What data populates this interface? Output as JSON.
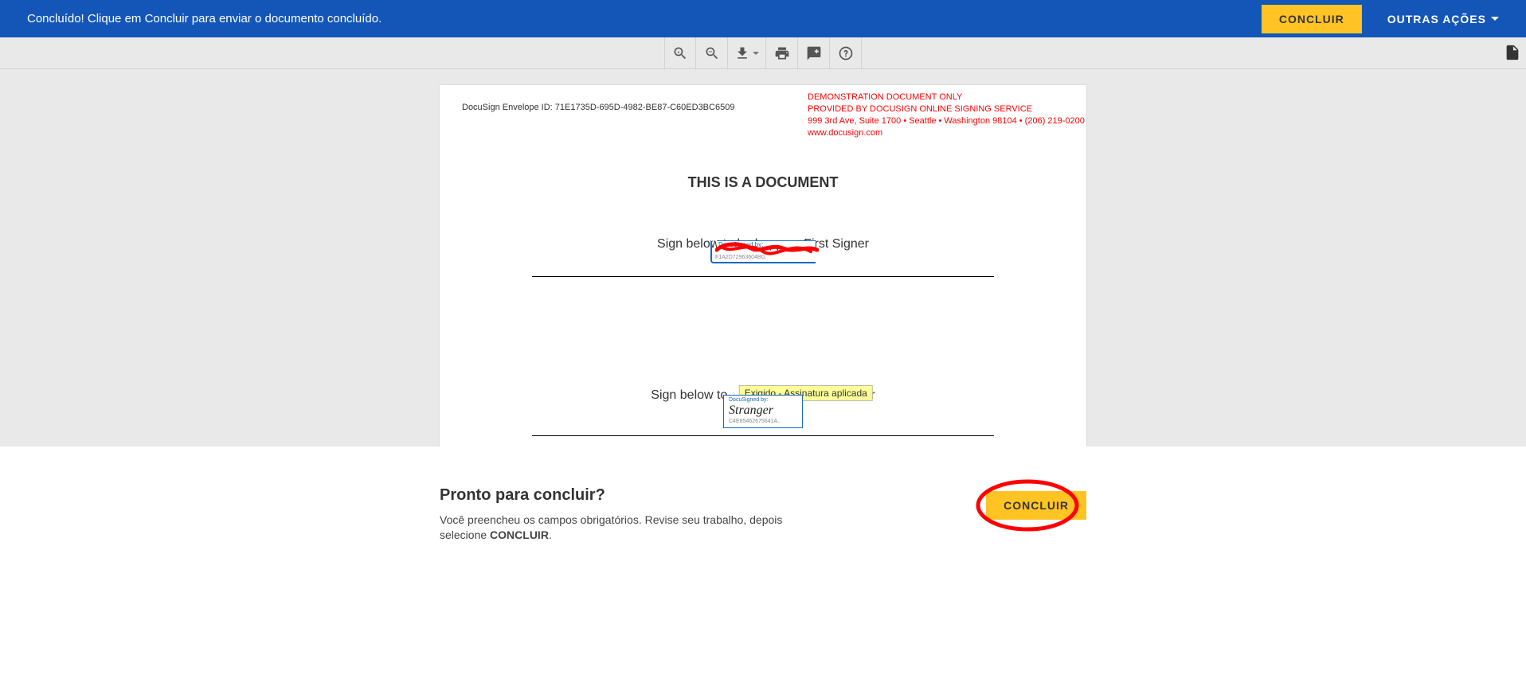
{
  "topbar": {
    "message": "Concluído! Clique em Concluir para enviar o documento concluído.",
    "finish_label": "CONCLUIR",
    "other_actions_label": "OUTRAS AÇÕES"
  },
  "document": {
    "envelope_id_label": "DocuSign Envelope ID: 71E1735D-695D-4982-BE87-C60ED3BC6509",
    "demo": {
      "line1": "DEMONSTRATION DOCUMENT ONLY",
      "line2": "PROVIDED BY DOCUSIGN ONLINE SIGNING SERVICE",
      "line3": "999 3rd Ave, Suite 1700  • Seattle • Washington 98104 • (206) 219-0200",
      "line4": "www.docusign.com"
    },
    "title": "THIS IS A DOCUMENT",
    "signer1": {
      "label": "Sign below to be happy – First Signer",
      "docusigned_by": "DocuSigned by:",
      "sig_id": "F1A2D72963604BG"
    },
    "signer2": {
      "label_visible_prefix": "Sign below to",
      "label_visible_suffix": "r",
      "tooltip": "Exigido - Assinatura aplicada",
      "docusigned_by": "DocuSigned by:",
      "sig_name": "Stranger",
      "sig_id": "C4E85462675641A.."
    }
  },
  "footer": {
    "title": "Pronto para concluir?",
    "subtitle_1": "Você preencheu os campos obrigatórios. Revise seu trabalho, depois selecione ",
    "subtitle_bold": "CONCLUIR",
    "subtitle_end": ".",
    "button_label": "CONCLUIR"
  }
}
